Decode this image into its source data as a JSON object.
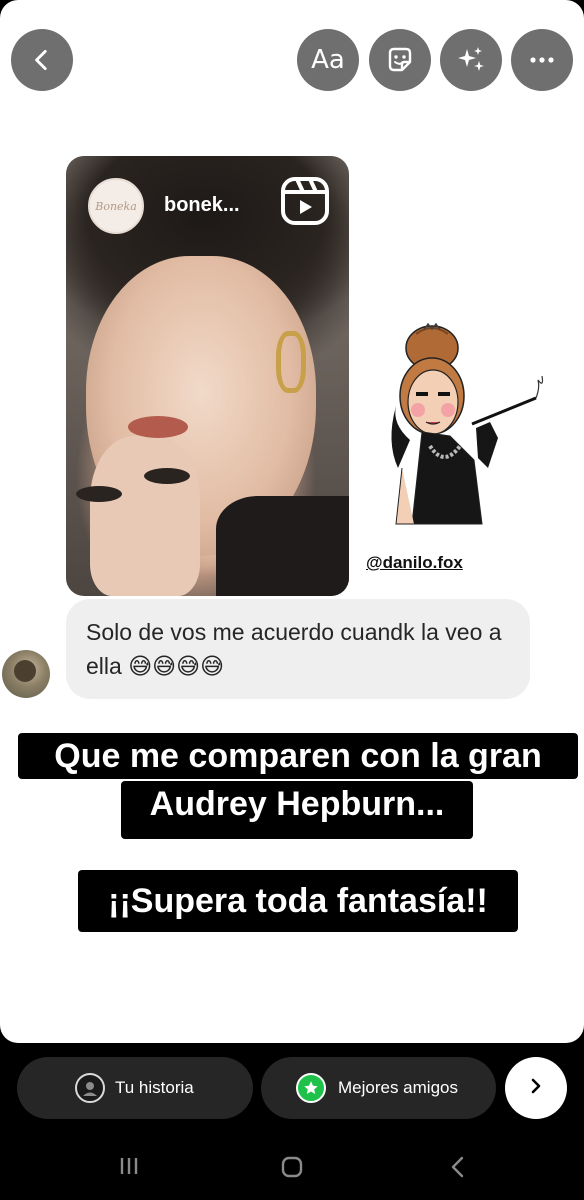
{
  "toolbar": {
    "back_icon": "chevron-left-icon",
    "text_tool_label": "Aa",
    "sticker_icon": "sticker-icon",
    "effects_icon": "sparkles-icon",
    "more_icon": "more-horizontal-icon"
  },
  "shared_post": {
    "username": "bonek...",
    "logo_text": "Boneka",
    "reels_icon": "reels-icon"
  },
  "credit_mention": "@danilo.fox",
  "message": {
    "text": "Solo de vos me acuerdo cuandk la veo a ella 😅😅😅😅"
  },
  "captions": {
    "line1": "Que me comparen con la gran",
    "line2": "Audrey Hepburn...",
    "line3": "¡¡Supera toda fantasía!!"
  },
  "share_bar": {
    "your_story_label": "Tu historia",
    "close_friends_label": "Mejores amigos",
    "close_friends_color": "#1ec24a",
    "next_icon": "chevron-right-icon"
  },
  "system_nav": {
    "recent_icon": "recent-apps-icon",
    "home_icon": "home-icon",
    "back_icon": "back-icon"
  }
}
